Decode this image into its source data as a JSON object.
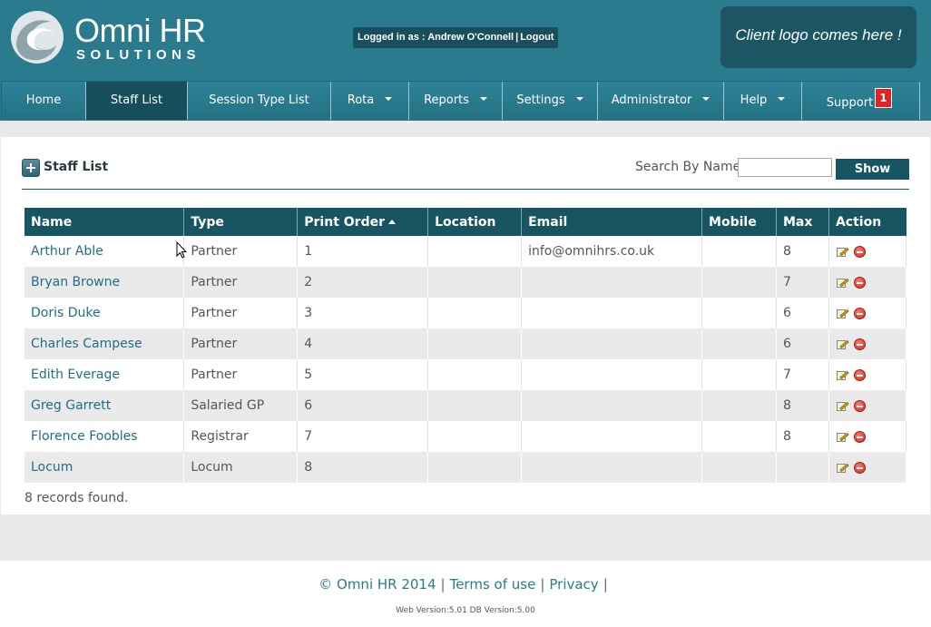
{
  "header": {
    "logo_main": "Omni HR",
    "logo_sub": "SOLUTIONS",
    "logged_in_prefix": "Logged in as : ",
    "user": "Andrew O'Connell",
    "separator": "|",
    "logout": "Logout",
    "client_logo": "Client logo comes here !",
    "colors": {
      "header_bg": "#2a7b8e",
      "nav_active": "#164e5b",
      "table_header": "#185563"
    }
  },
  "nav": {
    "items": [
      {
        "label": "Home"
      },
      {
        "label": "Staff List",
        "active": true
      },
      {
        "label": "Session Type List"
      },
      {
        "label": "Rota",
        "dropdown": true
      },
      {
        "label": "Reports",
        "dropdown": true
      },
      {
        "label": "Settings",
        "dropdown": true
      },
      {
        "label": "Administrator",
        "dropdown": true
      },
      {
        "label": "Help",
        "dropdown": true
      },
      {
        "label": "Support",
        "badge": "1"
      }
    ]
  },
  "page": {
    "title": "Staff List",
    "search_label": "Search By Name:",
    "search_value": "",
    "show_button": "Show"
  },
  "table": {
    "columns": [
      "Name",
      "Type",
      "Print Order",
      "Location",
      "Email",
      "Mobile",
      "Max",
      "Action"
    ],
    "sort_column": "Print Order",
    "rows": [
      {
        "name": "Arthur Able",
        "type": "Partner",
        "order": "1",
        "location": "",
        "email": "info@omnihrs.co.uk",
        "mobile": "",
        "max": "8"
      },
      {
        "name": "Bryan Browne",
        "type": "Partner",
        "order": "2",
        "location": "",
        "email": "",
        "mobile": "",
        "max": "7"
      },
      {
        "name": "Doris Duke",
        "type": "Partner",
        "order": "3",
        "location": "",
        "email": "",
        "mobile": "",
        "max": "6"
      },
      {
        "name": "Charles Campese",
        "type": "Partner",
        "order": "4",
        "location": "",
        "email": "",
        "mobile": "",
        "max": "6"
      },
      {
        "name": "Edith Everage",
        "type": "Partner",
        "order": "5",
        "location": "",
        "email": "",
        "mobile": "",
        "max": "7"
      },
      {
        "name": "Greg Garrett",
        "type": "Salaried GP",
        "order": "6",
        "location": "",
        "email": "",
        "mobile": "",
        "max": "8"
      },
      {
        "name": "Florence Foobles",
        "type": "Registrar",
        "order": "7",
        "location": "",
        "email": "",
        "mobile": "",
        "max": "8"
      },
      {
        "name": "Locum",
        "type": "Locum",
        "order": "8",
        "location": "",
        "email": "",
        "mobile": "",
        "max": ""
      }
    ],
    "records_found": "8 records found."
  },
  "footer": {
    "copyright": "© Omni HR 2014",
    "terms": "Terms of use",
    "privacy": "Privacy",
    "separator": "|",
    "version": "Web Version:5.01 DB Version:5.00"
  }
}
